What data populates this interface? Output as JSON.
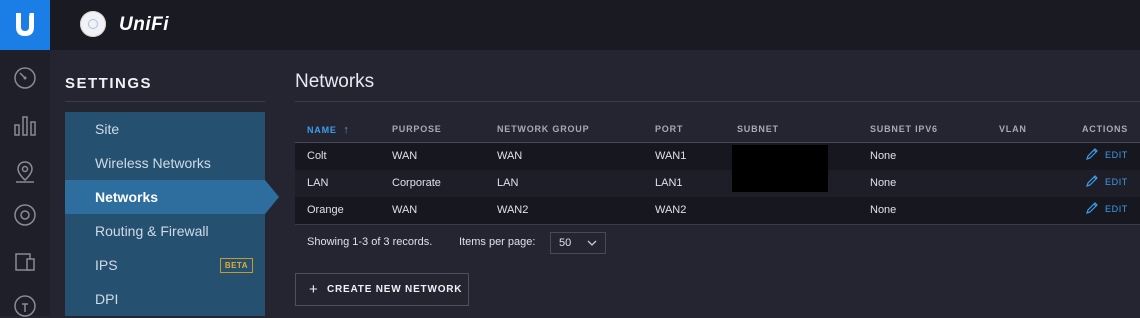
{
  "app": {
    "title": "UniFi"
  },
  "settings": {
    "title": "SETTINGS",
    "menu": [
      {
        "label": "Site"
      },
      {
        "label": "Wireless Networks"
      },
      {
        "label": "Networks",
        "active": true
      },
      {
        "label": "Routing & Firewall"
      },
      {
        "label": "IPS",
        "badge": "BETA"
      },
      {
        "label": "DPI"
      }
    ]
  },
  "main": {
    "title": "Networks",
    "columns": {
      "name": "NAME",
      "sort_indicator": "↑",
      "purpose": "PURPOSE",
      "network_group": "NETWORK GROUP",
      "port": "PORT",
      "subnet": "SUBNET",
      "subnet_ipv6": "SUBNET IPV6",
      "vlan": "VLAN",
      "actions": "ACTIONS"
    },
    "rows": [
      {
        "name": "Colt",
        "purpose": "WAN",
        "network_group": "WAN",
        "port": "WAN1",
        "subnet": "",
        "subnet_ipv6": "None",
        "vlan": "",
        "action": "EDIT"
      },
      {
        "name": "LAN",
        "purpose": "Corporate",
        "network_group": "LAN",
        "port": "LAN1",
        "subnet": "",
        "subnet_ipv6": "None",
        "vlan": "",
        "action": "EDIT"
      },
      {
        "name": "Orange",
        "purpose": "WAN",
        "network_group": "WAN2",
        "port": "WAN2",
        "subnet": "",
        "subnet_ipv6": "None",
        "vlan": "",
        "action": "EDIT"
      }
    ],
    "records_text": "Showing 1-3 of 3 records.",
    "items_per_page_label": "Items per page:",
    "items_per_page_value": "50",
    "create_button_label": "CREATE NEW NETWORK",
    "create_button_icon": "+"
  },
  "icons": {
    "brand": "ubiquiti-logo-icon",
    "rail": [
      "dashboard-gauge-icon",
      "statistics-bars-icon",
      "map-pin-icon",
      "devices-circle-icon",
      "clients-devices-icon",
      "insights-icon"
    ]
  },
  "colors": {
    "accent": "#1a7ee6",
    "link": "#3b9dea",
    "active_menu": "#2d6e9e",
    "menu": "#25506f",
    "beta": "#e2ad34"
  }
}
